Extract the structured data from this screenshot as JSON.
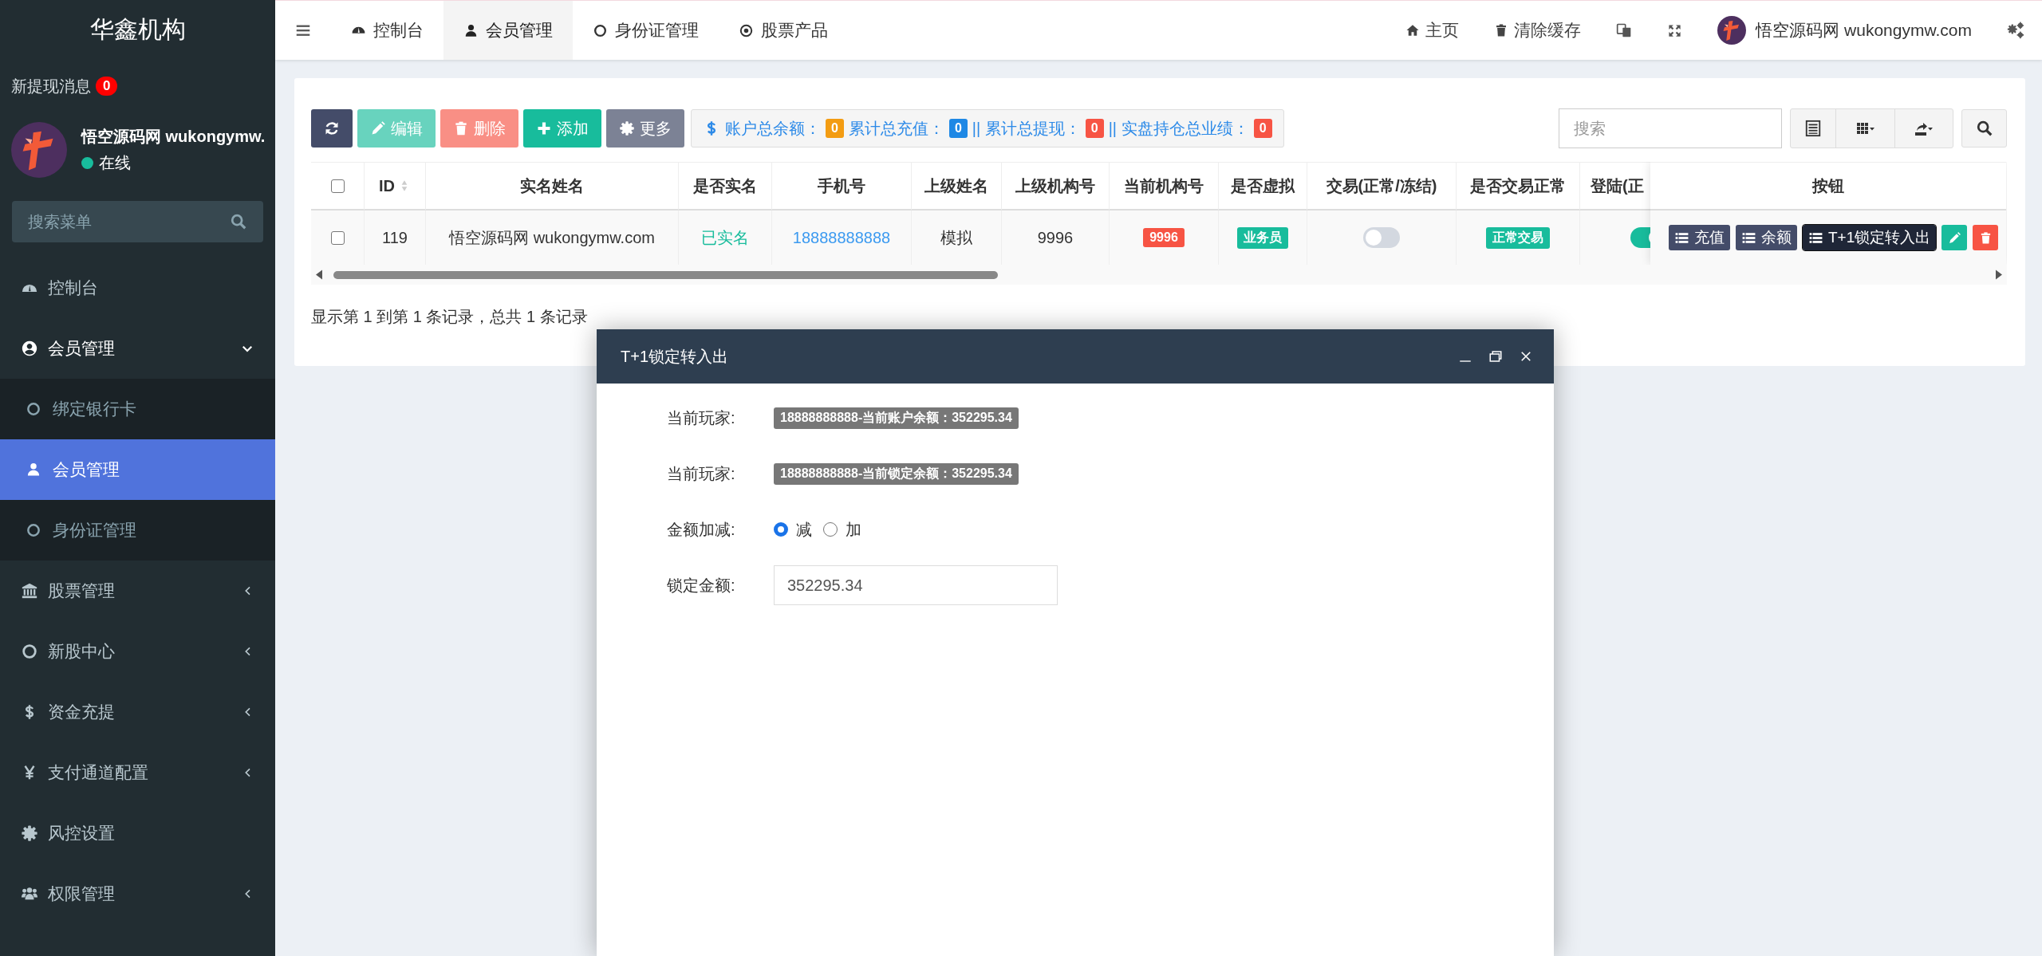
{
  "sidebar": {
    "brand": "华鑫机构",
    "notice": {
      "label": "新提现消息",
      "count": "0"
    },
    "user": {
      "name": "悟空源码网 wukongymw.",
      "status": "在线",
      "online": true
    },
    "search": {
      "placeholder": "搜索菜单"
    },
    "menu": [
      {
        "label": "控制台"
      },
      {
        "label": "会员管理",
        "expanded": true,
        "children": [
          {
            "label": "绑定银行卡",
            "selected": false
          },
          {
            "label": "会员管理",
            "selected": true
          },
          {
            "label": "身份证管理",
            "selected": false
          }
        ]
      },
      {
        "label": "股票管理",
        "expanded": false
      },
      {
        "label": "新股中心",
        "expanded": false
      },
      {
        "label": "资金充提",
        "expanded": false
      },
      {
        "label": "支付通道配置",
        "expanded": false
      },
      {
        "label": "风控设置"
      },
      {
        "label": "权限管理",
        "expanded": false
      }
    ]
  },
  "topbar": {
    "tabs": [
      {
        "label": "控制台",
        "selected": false
      },
      {
        "label": "会员管理",
        "selected": true
      },
      {
        "label": "身份证管理",
        "selected": false
      },
      {
        "label": "股票产品",
        "selected": false
      }
    ],
    "links": [
      {
        "label": "主页"
      },
      {
        "label": "清除缓存"
      }
    ],
    "user": {
      "name": "悟空源码网 wukongymw.com"
    }
  },
  "toolbar": {
    "buttons": [
      {
        "kind": "refresh",
        "disabled": false
      },
      {
        "kind": "edit",
        "label": "编辑",
        "disabled": true
      },
      {
        "kind": "delete",
        "label": "删除",
        "disabled": true
      },
      {
        "kind": "add",
        "label": "添加",
        "disabled": false
      },
      {
        "kind": "more",
        "label": "更多",
        "disabled": false
      }
    ],
    "summary": [
      {
        "label": "账户总余额：",
        "value": "0",
        "color": "#f39c12"
      },
      {
        "label": "累计总充值：",
        "value": "0",
        "color": "#1e88e5"
      },
      {
        "label": "|| 累计总提现：",
        "value": "0",
        "color": "#f75444"
      },
      {
        "label": "|| 实盘持仓总业绩：",
        "value": "0",
        "color": "#f75444"
      }
    ],
    "search": {
      "placeholder": "搜索"
    }
  },
  "table": {
    "select_all": {
      "checked": false
    },
    "columns": [
      {
        "label": "ID",
        "sortable": true
      },
      {
        "label": "实名姓名",
        "sortable": false
      },
      {
        "label": "是否实名",
        "sortable": false
      },
      {
        "label": "手机号",
        "sortable": false
      },
      {
        "label": "上级姓名",
        "sortable": false
      },
      {
        "label": "上级机构号",
        "sortable": false
      },
      {
        "label": "当前机构号",
        "sortable": false
      },
      {
        "label": "是否虚拟",
        "sortable": false
      },
      {
        "label": "交易(正常/冻结)",
        "sortable": false
      },
      {
        "label": "是否交易正常",
        "sortable": false
      },
      {
        "label": "登陆(正",
        "sortable": false
      }
    ],
    "rows": [
      {
        "checked": false,
        "cells": [
          {
            "kind": "text",
            "text": "119"
          },
          {
            "kind": "text",
            "text": "悟空源码网 wukongymw.com"
          },
          {
            "kind": "status",
            "text": "已实名"
          },
          {
            "kind": "link",
            "text": "18888888888"
          },
          {
            "kind": "text",
            "text": "模拟"
          },
          {
            "kind": "text",
            "text": "9996"
          },
          {
            "kind": "badge",
            "text": "9996",
            "color": "#f75444"
          },
          {
            "kind": "badge",
            "text": "业务员",
            "color": "#18bc9c"
          },
          {
            "kind": "toggle",
            "on": false
          },
          {
            "kind": "badge",
            "text": "正常交易",
            "color": "#18bc9c"
          },
          {
            "kind": "toggle",
            "on": true
          }
        ]
      }
    ],
    "action_column": {
      "title": "按钮",
      "buttons": [
        {
          "kind": "list",
          "label": "充值",
          "selected": false
        },
        {
          "kind": "list",
          "label": "余额",
          "selected": false
        },
        {
          "kind": "list",
          "label": "T+1锁定转入出",
          "selected": true
        },
        {
          "kind": "edit"
        },
        {
          "kind": "delete"
        }
      ]
    }
  },
  "pagination_info": "显示第 1 到第 1 条记录，总共 1 条记录",
  "dialog": {
    "title": "T+1锁定转入出",
    "rows": [
      {
        "kind": "badge",
        "label": "当前玩家:",
        "text": "18888888888-当前账户余额：352295.34"
      },
      {
        "kind": "badge",
        "label": "当前玩家:",
        "text": "18888888888-当前锁定余额：352295.34"
      },
      {
        "kind": "radio",
        "label": "金额加减:",
        "options": [
          {
            "label": "减",
            "selected": true
          },
          {
            "label": "加",
            "selected": false
          }
        ]
      },
      {
        "kind": "input",
        "label": "锁定金额:",
        "value": "352295.34"
      }
    ]
  }
}
